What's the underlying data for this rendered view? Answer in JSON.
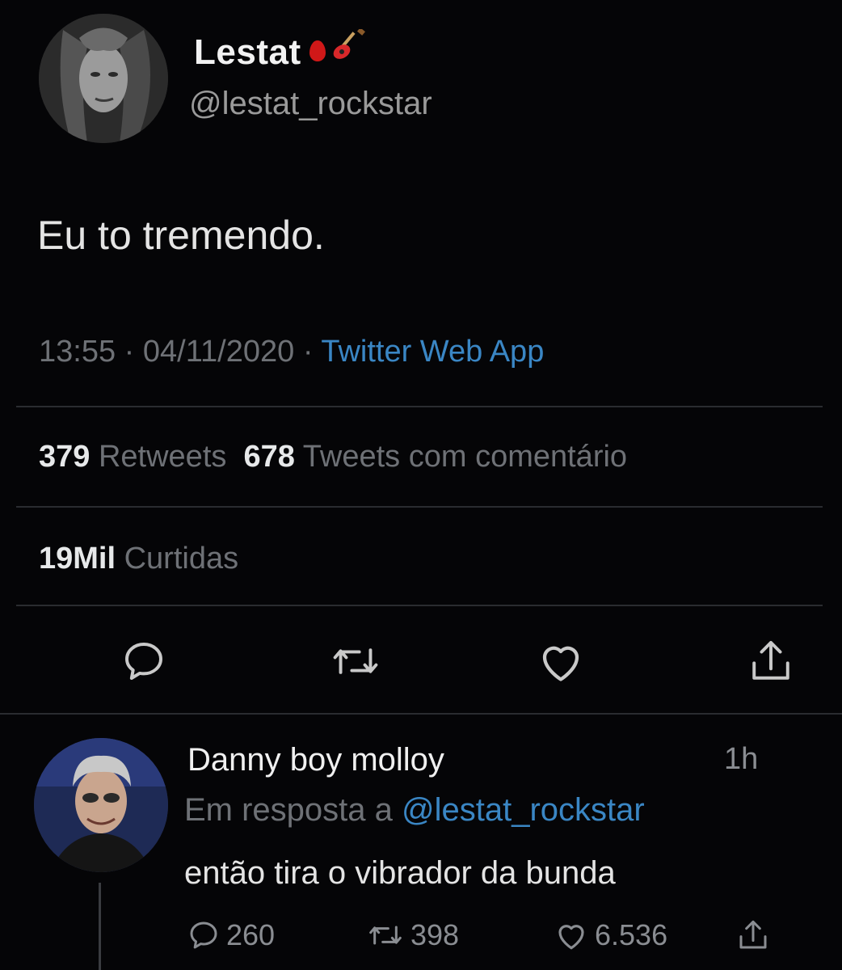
{
  "tweet": {
    "display_name": "Lestat",
    "handle": "@lestat_rockstar",
    "text": "Eu to tremendo.",
    "time": "13:55",
    "date": "04/11/2020",
    "separator": "·",
    "source": "Twitter Web App",
    "retweets_count": "379",
    "retweets_label": "Retweets",
    "quotes_count": "678",
    "quotes_label": "Tweets com comentário",
    "likes_count": "19Mil",
    "likes_label": "Curtidas",
    "icons": [
      "drop-of-blood-icon",
      "guitar-icon",
      "reply-icon",
      "retweet-icon",
      "like-icon",
      "share-icon"
    ]
  },
  "reply": {
    "display_name": "Danny boy molloy",
    "time_ago": "1h",
    "in_reply_prefix": "Em resposta a",
    "in_reply_handle": "@lestat_rockstar",
    "text": "então tira o vibrador da bunda",
    "reply_count": "260",
    "retweet_count": "398",
    "like_count": "6.536"
  },
  "colors": {
    "background": "#050507",
    "link_blue": "#3a86c4",
    "muted_gray": "#6e7176",
    "text_white": "#e7e9ea"
  }
}
